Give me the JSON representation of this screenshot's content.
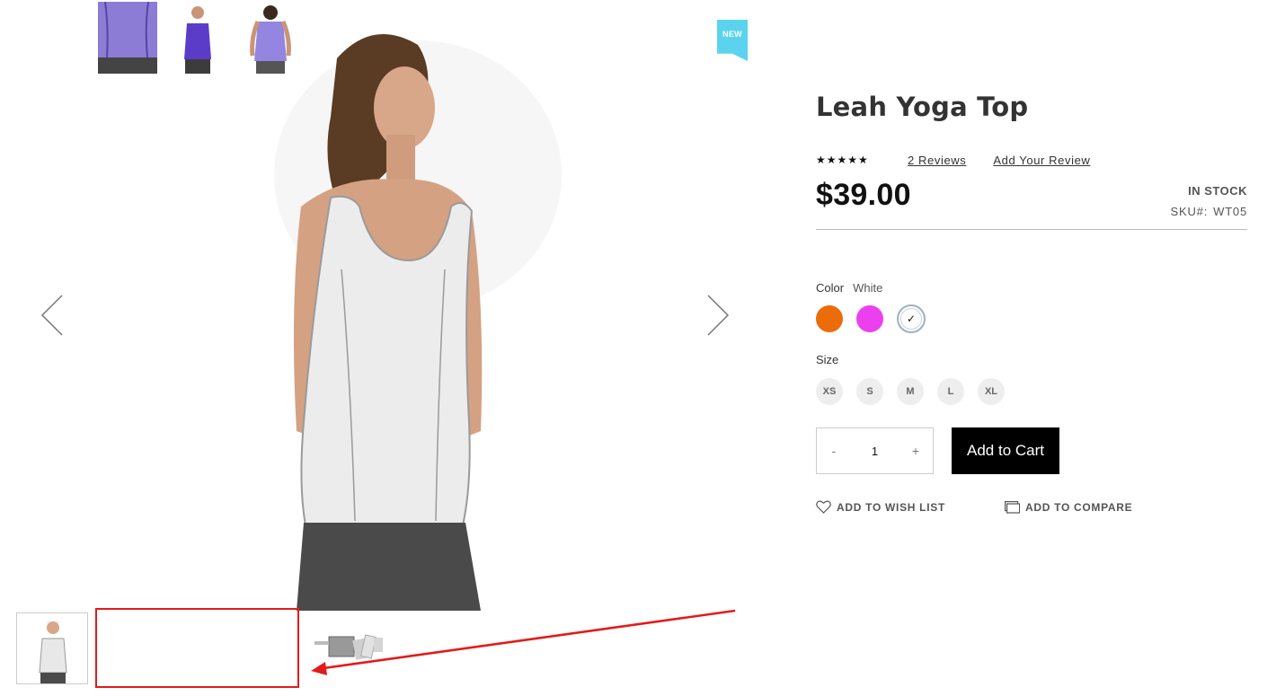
{
  "gallery": {
    "badge": "NEW",
    "prev_icon": "chevron-left-icon",
    "next_icon": "chevron-right-icon",
    "thumbnails": [
      "white tank",
      "purple tank close-up",
      "purple tank front",
      "purple tank back",
      "brochure"
    ]
  },
  "product": {
    "title": "Leah Yoga Top",
    "stars": "★★★★★",
    "reviews_link": "2 Reviews",
    "add_review_link": "Add Your Review",
    "price": "$39.00",
    "stock": "IN STOCK",
    "sku_label": "SKU#:",
    "sku_value": "WT05"
  },
  "options": {
    "color_label": "Color",
    "color_selected": "White",
    "colors": [
      {
        "name": "Orange",
        "hex": "#ec6c0a"
      },
      {
        "name": "Purple",
        "hex": "#ec40ef"
      },
      {
        "name": "White",
        "hex": "#ffffff",
        "selected": true
      }
    ],
    "check_mark": "✓",
    "size_label": "Size",
    "sizes": [
      "XS",
      "S",
      "M",
      "L",
      "XL"
    ]
  },
  "cart": {
    "minus": "-",
    "quantity": "1",
    "plus": "+",
    "add_to_cart": "Add to Cart"
  },
  "actions": {
    "wishlist": "ADD TO WISH LIST",
    "compare": "ADD TO COMPARE"
  },
  "colors": {
    "badge": "#5bd3ee",
    "annotation": "#e21b1b",
    "button": "#000000"
  }
}
